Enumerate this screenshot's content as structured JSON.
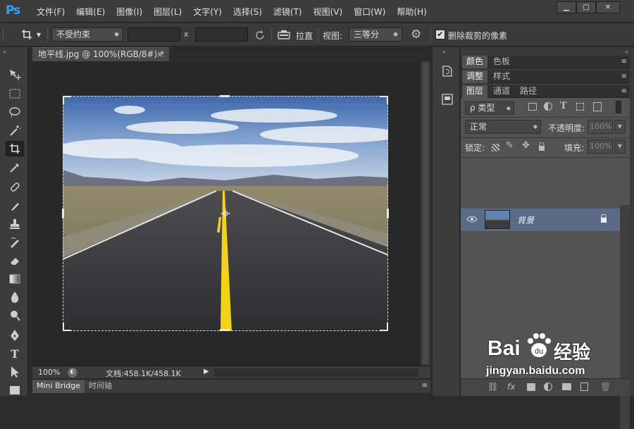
{
  "app": {
    "logo": "Ps"
  },
  "menu": [
    "文件(F)",
    "编辑(E)",
    "图像(I)",
    "图层(L)",
    "文字(Y)",
    "选择(S)",
    "滤镜(T)",
    "视图(V)",
    "窗口(W)",
    "帮助(H)"
  ],
  "window_controls": {
    "minimize": "▁",
    "maximize": "□",
    "close": "✕"
  },
  "options": {
    "ratio_select": "不受约束",
    "x_label": "x",
    "straighten_label": "拉直",
    "view_label": "视图:",
    "view_select": "三等分",
    "delete_cropped_label": "删除裁剪的像素",
    "delete_cropped_checked": true
  },
  "document": {
    "tab_title": "地平线.jpg @ 100%(RGB/8#) *",
    "close_glyph": "×",
    "zoom": "100%",
    "doc_info": "文档:458.1K/458.1K"
  },
  "bottom_tabs": [
    "Mini Bridge",
    "时间轴"
  ],
  "panels": {
    "group1_tabs": [
      "颜色",
      "色板"
    ],
    "group2_tabs": [
      "调整",
      "样式"
    ],
    "group3_tabs": [
      "图层",
      "通道",
      "路径"
    ],
    "filter_label": "ρ 类型",
    "blend_mode": "正常",
    "opacity_label": "不透明度:",
    "opacity_value": "100%",
    "lock_label": "锁定:",
    "fill_label": "填充:",
    "fill_value": "100%",
    "layer_name": "背景"
  },
  "watermark": {
    "brand": "Bai",
    "brand_cn": "经验",
    "url": "jingyan.baidu.com"
  },
  "colors": {
    "accent_blue": "#2fa3ff",
    "layer_selected": "#5a6b85",
    "road_line": "#f2d21b",
    "sky": "#4d77b7"
  }
}
